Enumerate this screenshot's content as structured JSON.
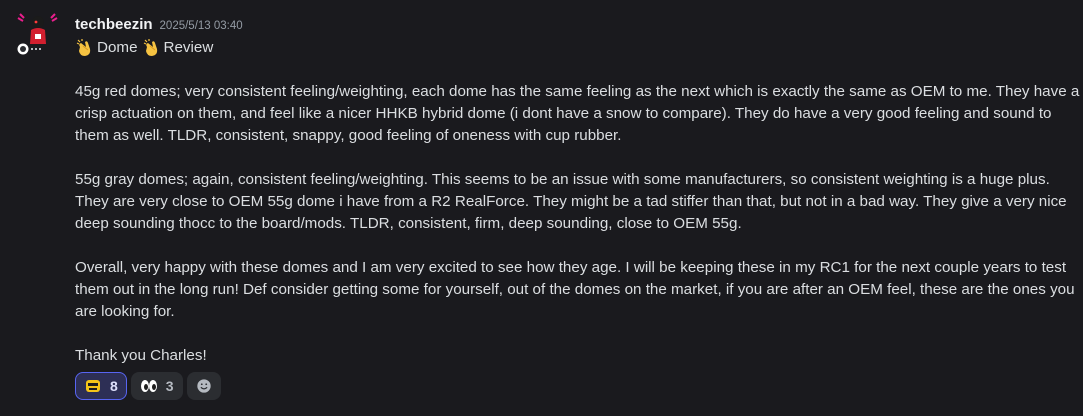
{
  "message": {
    "author": "techbeezin",
    "timestamp": "2025/5/13 03:40",
    "title": {
      "word1": "Dome",
      "word2": "Review",
      "emoji": "clapping-hands-icon"
    },
    "paragraphs": [
      "45g red domes; very consistent feeling/weighting, each dome has the same feeling as the next which is exactly the same as OEM to me. They have a crisp actuation on them, and feel like a nicer HHKB hybrid dome (i dont have a snow to compare). They do have a very good feeling and sound to them as well. TLDR, consistent, snappy, good feeling of oneness with cup rubber.",
      "55g gray domes; again, consistent feeling/weighting. This seems to be an issue with some manufacturers, so consistent weighting is a huge plus. They are very close to OEM 55g dome i have from a R2 RealForce. They might be a tad stiffer than that, but not in a bad way. They give a very nice deep sounding thocc to the board/mods. TLDR, consistent, firm, deep sounding, close to OEM 55g.",
      "Overall, very happy with these domes and I am very excited to see how they age. I will be keeping these in my RC1 for the next couple years to test them out in the long run! Def consider getting some for yourself, out of the domes on the market, if you are after an OEM feel, these are the ones you are looking for.",
      "Thank you Charles!"
    ]
  },
  "reactions": [
    {
      "icon": "custom-emoji-icon",
      "count": "8",
      "active": true
    },
    {
      "icon": "eyes-icon",
      "count": "3",
      "active": false
    },
    {
      "icon": "add-reaction-icon",
      "count": "",
      "active": false
    }
  ],
  "colors": {
    "background": "#1a1a1e",
    "username": "#f2f3f5",
    "text": "#dbdee1",
    "timestamp": "#949ba4",
    "reaction_active_border": "#5865f2",
    "avatar_accent": "#e91e8c"
  }
}
